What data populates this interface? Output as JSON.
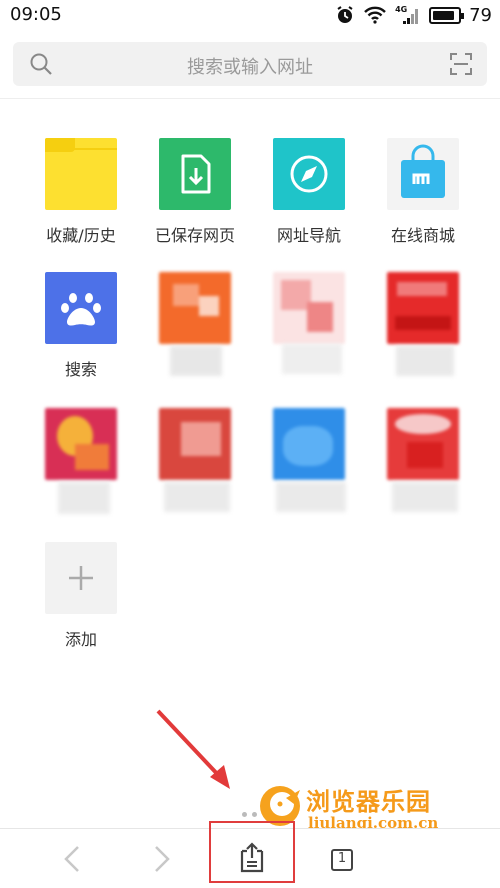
{
  "status_bar": {
    "time": "09:05",
    "network": "4G",
    "battery": "79"
  },
  "search": {
    "placeholder": "搜索或输入网址"
  },
  "shortcuts": [
    {
      "label": "收藏/历史",
      "icon": "folder-icon",
      "color": "#fde030"
    },
    {
      "label": "已保存网页",
      "icon": "saved-page-icon",
      "color": "#2db96b"
    },
    {
      "label": "网址导航",
      "icon": "compass-icon",
      "color": "#1fc4c9"
    },
    {
      "label": "在线商城",
      "icon": "shopping-bag-icon",
      "color": "#f3f3f3"
    },
    {
      "label": "搜索",
      "icon": "paw-icon",
      "color": "#4d71e8"
    },
    {
      "label": "添加",
      "icon": "plus-icon",
      "color": "#f2f2f2"
    }
  ],
  "nav": {
    "tab_count": "1"
  },
  "watermark": {
    "title": "浏览器乐园",
    "url": "liulanqi.com.cn"
  }
}
